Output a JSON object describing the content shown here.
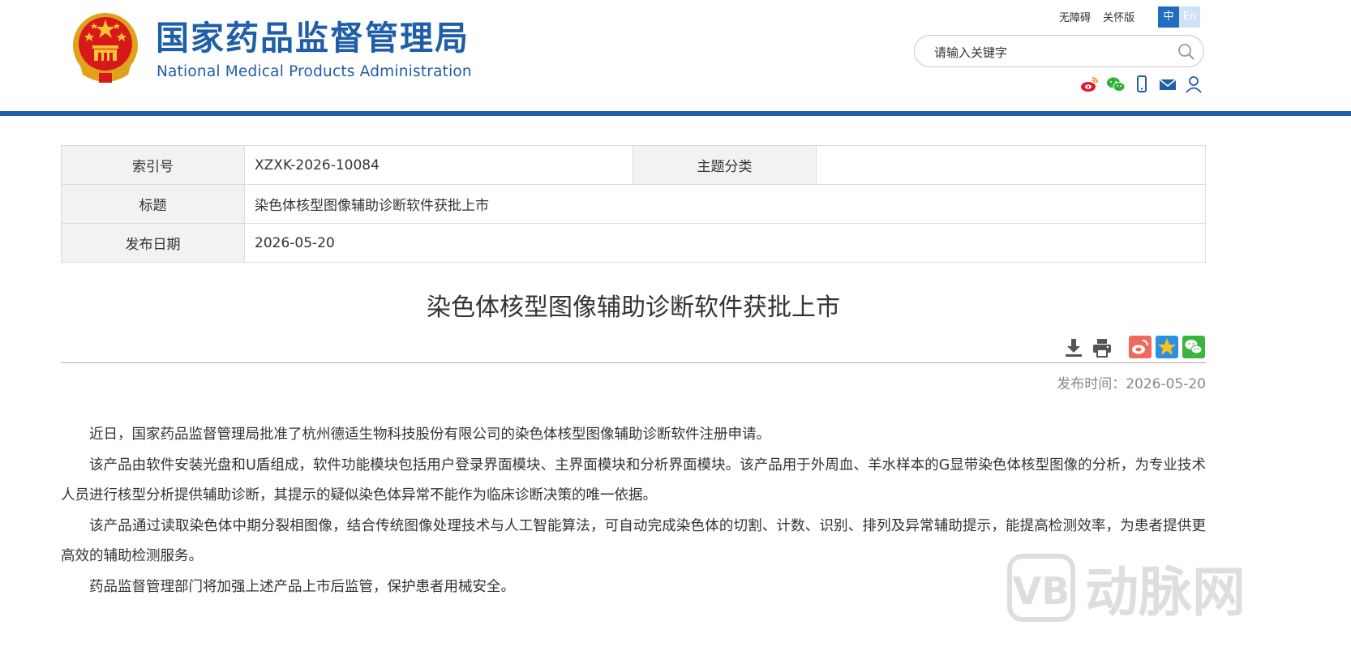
{
  "header": {
    "site_name_cn": "国家药品监督管理局",
    "site_name_en": "National Medical Products Administration",
    "links": {
      "accessible": "无障碍",
      "elder": "关怀版"
    },
    "lang": {
      "zh": "中",
      "en": "En"
    },
    "search": {
      "placeholder": "请输入关键字",
      "value": ""
    },
    "share_icons": [
      "weibo-icon",
      "wechat-icon",
      "mobile-icon",
      "mail-icon",
      "user-icon"
    ],
    "accent_color": "#1f5ea8"
  },
  "meta": {
    "index_label": "索引号",
    "index_value": "XZXK-2026-10084",
    "topic_label": "主题分类",
    "topic_value": "",
    "title_label": "标题",
    "title_value": "染色体核型图像辅助诊断软件获批上市",
    "date_label": "发布日期",
    "date_value": "2026-05-20"
  },
  "article": {
    "title": "染色体核型图像辅助诊断软件获批上市",
    "publish_time": "发布时间：2026-05-20",
    "tools": [
      "download-icon",
      "print-icon",
      "share-weibo-icon",
      "share-qzone-icon",
      "share-wechat-icon"
    ],
    "paragraphs": [
      "近日，国家药品监督管理局批准了杭州德适生物科技股份有限公司的染色体核型图像辅助诊断软件注册申请。",
      "该产品由软件安装光盘和U盾组成，软件功能模块包括用户登录界面模块、主界面模块和分析界面模块。该产品用于外周血、羊水样本的G显带染色体核型图像的分析，为专业技术人员进行核型分析提供辅助诊断，其提示的疑似染色体异常不能作为临床诊断决策的唯一依据。",
      "该产品通过读取染色体中期分裂相图像，结合传统图像处理技术与人工智能算法，可自动完成染色体的切割、计数、识别、排列及异常辅助提示，能提高检测效率，为患者提供更高效的辅助检测服务。",
      "药品监督管理部门将加强上述产品上市后监管，保护患者用械安全。"
    ]
  },
  "watermark": {
    "text": "动脉网"
  }
}
